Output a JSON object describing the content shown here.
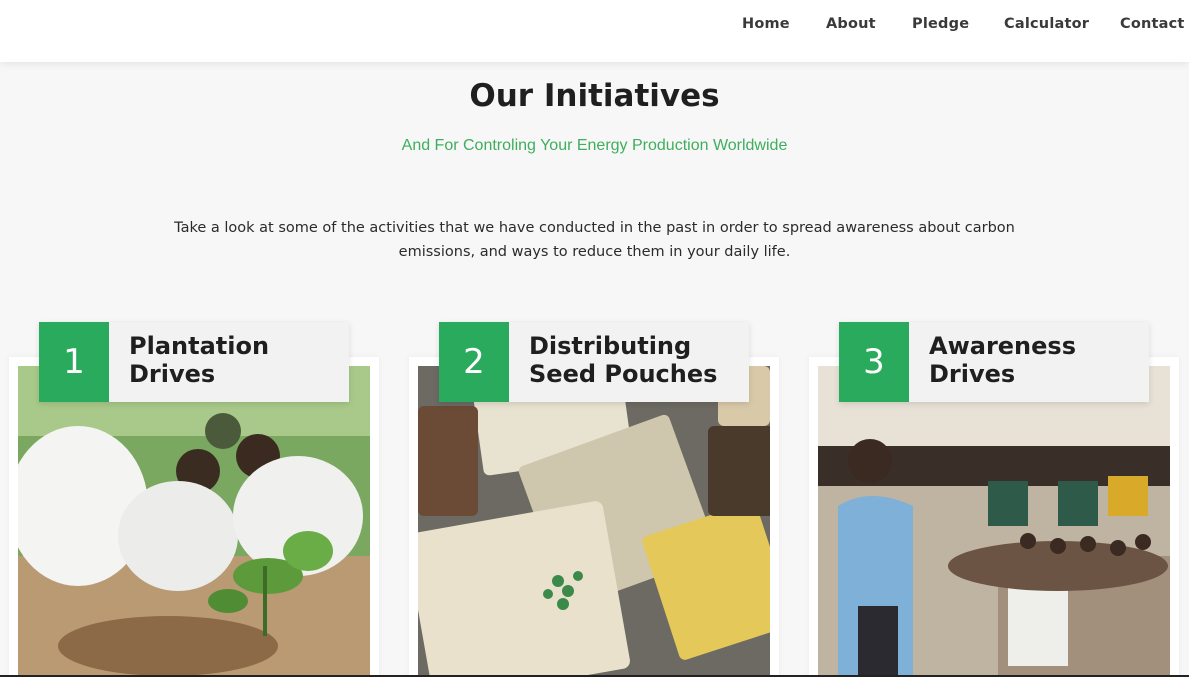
{
  "nav": {
    "links": [
      "Home",
      "About",
      "Pledge",
      "Calculator",
      "Contact"
    ]
  },
  "section": {
    "title": "Our Initiatives",
    "subtitle": "And For Controling Your Energy Production Worldwide",
    "intro": "Take a look at some of the activities that we have conducted in the past in order to spread awareness about carbon emissions, and ways to reduce them in your daily life."
  },
  "cards": [
    {
      "number": "1",
      "title_line1": "Plantation",
      "title_line2": "Drives",
      "photo_icon": "plantation-photo"
    },
    {
      "number": "2",
      "title_line1": "Distributing",
      "title_line2": "Seed Pouches",
      "photo_icon": "seeds-photo"
    },
    {
      "number": "3",
      "title_line1": "Awareness",
      "title_line2": "Drives",
      "photo_icon": "seminar-photo"
    }
  ],
  "colors": {
    "accent_green": "#2aaa5c",
    "subtitle_green": "#3fae5d",
    "background": "#f7f7f7",
    "nav_background": "#ffffff"
  }
}
